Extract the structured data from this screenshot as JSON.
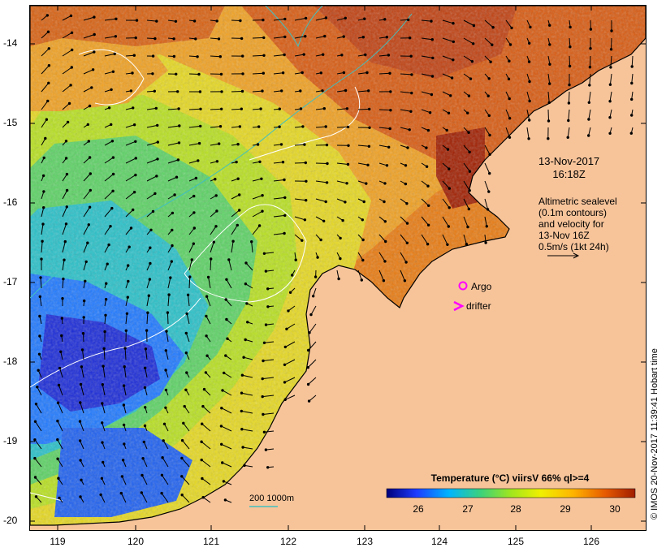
{
  "map": {
    "y_axis": {
      "labels": [
        "-14",
        "-15",
        "-16",
        "-17",
        "-18",
        "-19",
        "-20"
      ]
    },
    "x_axis": {
      "labels": [
        "119",
        "120",
        "121",
        "122",
        "123",
        "124",
        "125",
        "126"
      ]
    },
    "lon_range": [
      118.65,
      126.75
    ],
    "lat_range": [
      -20.1,
      -13.55
    ],
    "annotations": {
      "date": "13-Nov-2017",
      "time": "16:18Z",
      "altimetry_lines": [
        "Altimetric sealevel",
        "(0.1m contours)",
        "and velocity for",
        "13-Nov 16Z",
        "0.5m/s (1kt 24h)"
      ]
    },
    "legend": {
      "argo_label": "Argo",
      "drifter_label": "drifter",
      "argo_color": "#ff00ff",
      "drifter_color": "#ff00ff"
    },
    "colorbar": {
      "title": "Temperature (°C) viirsV 66% ql>=4",
      "ticks": [
        "26",
        "27",
        "28",
        "29",
        "30"
      ],
      "colors": [
        "#00007a",
        "#1e3cff",
        "#00b4ff",
        "#3cd27a",
        "#a0e61e",
        "#f0f000",
        "#ffb400",
        "#e65a00",
        "#a01e00"
      ]
    },
    "scale_label": "200  1000m",
    "scale_color": "#40c0c0",
    "land_color": "#f7c49a",
    "credit": "© IMOS 20-Nov-2017 11:39:41 Hobart time"
  }
}
